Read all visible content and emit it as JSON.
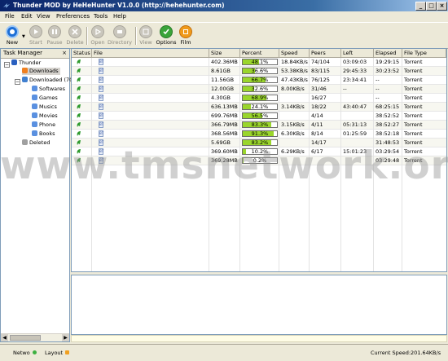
{
  "window": {
    "title": "Thunder MOD by HeHeHunter V1.0.0 (http://hehehunter.com)",
    "minimize": "_",
    "maximize": "□",
    "close": "×"
  },
  "menu": [
    "File",
    "Edit",
    "View",
    "Preferences",
    "Tools",
    "Help"
  ],
  "toolbar": {
    "new": "New",
    "start": "Start",
    "pause": "Pause",
    "delete": "Delete",
    "open": "Open",
    "directory": "Directory",
    "view": "View",
    "options": "Options",
    "film": "Film"
  },
  "task_manager": {
    "header": "Task Manager",
    "close": "×",
    "root": "Thunder",
    "items": [
      "Downloads",
      "Downloaded (70",
      "Softwares",
      "Games",
      "Musics",
      "Movies",
      "Phone",
      "Books",
      "Deleted"
    ]
  },
  "table": {
    "columns": [
      "Status",
      "File",
      "Size",
      "Percent",
      "Speed",
      "Peers",
      "Left",
      "Elapsed",
      "File Type"
    ],
    "file_icon_text": "BT",
    "rows": [
      {
        "size": "402.36MB",
        "percent": 48.1,
        "percent_text": "48.1%",
        "speed": "18.84KB/s",
        "peers": "74/104",
        "left": "03:09:03",
        "elapsed": "19:29:15",
        "type": "Torrent"
      },
      {
        "size": "8.61GB",
        "percent": 36.6,
        "percent_text": "36.6%",
        "speed": "53.38KB/s",
        "peers": "83/115",
        "left": "29:45:33",
        "elapsed": "30:23:52",
        "type": "Torrent"
      },
      {
        "size": "11.56GB",
        "percent": 66.7,
        "percent_text": "66.7%",
        "speed": "47.43KB/s",
        "peers": "76/125",
        "left": "23:34:41",
        "elapsed": "--",
        "type": "Torrent"
      },
      {
        "size": "12.00GB",
        "percent": 32.6,
        "percent_text": "32.6%",
        "speed": "8.00KB/s",
        "peers": "31/46",
        "left": "--",
        "elapsed": "--",
        "type": "Torrent"
      },
      {
        "size": "4.30GB",
        "percent": 68.9,
        "percent_text": "68.9%",
        "speed": "",
        "peers": "16/27",
        "left": "",
        "elapsed": "--",
        "type": "Torrent"
      },
      {
        "size": "636.13MB",
        "percent": 24.1,
        "percent_text": "24.1%",
        "speed": "3.14KB/s",
        "peers": "18/22",
        "left": "43:40:47",
        "elapsed": "68:25:15",
        "type": "Torrent"
      },
      {
        "size": "699.76MB",
        "percent": 56.5,
        "percent_text": "56.5%",
        "speed": "",
        "peers": "4/14",
        "left": "",
        "elapsed": "38:52:52",
        "type": "Torrent"
      },
      {
        "size": "366.79MB",
        "percent": 83.3,
        "percent_text": "83.3%",
        "speed": "3.15KB/s",
        "peers": "4/11",
        "left": "05:31:13",
        "elapsed": "38:52:27",
        "type": "Torrent"
      },
      {
        "size": "368.56MB",
        "percent": 91.3,
        "percent_text": "91.3%",
        "speed": "6.30KB/s",
        "peers": "8/14",
        "left": "01:25:59",
        "elapsed": "38:52:18",
        "type": "Torrent"
      },
      {
        "size": "5.69GB",
        "percent": 83.2,
        "percent_text": "83.2%",
        "speed": "",
        "peers": "14/17",
        "left": "",
        "elapsed": "31:48:53",
        "type": "Torrent"
      },
      {
        "size": "369.60MB",
        "percent": 10.2,
        "percent_text": "10.2%",
        "speed": "6.29KB/s",
        "peers": "6/17",
        "left": "15:01:23",
        "elapsed": "03:29:54",
        "type": "Torrent"
      },
      {
        "size": "369.28MB",
        "percent": 0.2,
        "percent_text": "0.2%",
        "speed": "",
        "peers": "",
        "left": "",
        "elapsed": "03:29:48",
        "type": "Torrent"
      }
    ]
  },
  "status": {
    "network": "Netwo",
    "layout": "Layout",
    "current_speed": "Current Speed:201.64KB/s"
  },
  "watermark": "www.tmsnetwork.org",
  "colors": {
    "titlebar": "#0a246a",
    "progress_fill": "#9ad62c",
    "network_dot": "#3cb040"
  }
}
